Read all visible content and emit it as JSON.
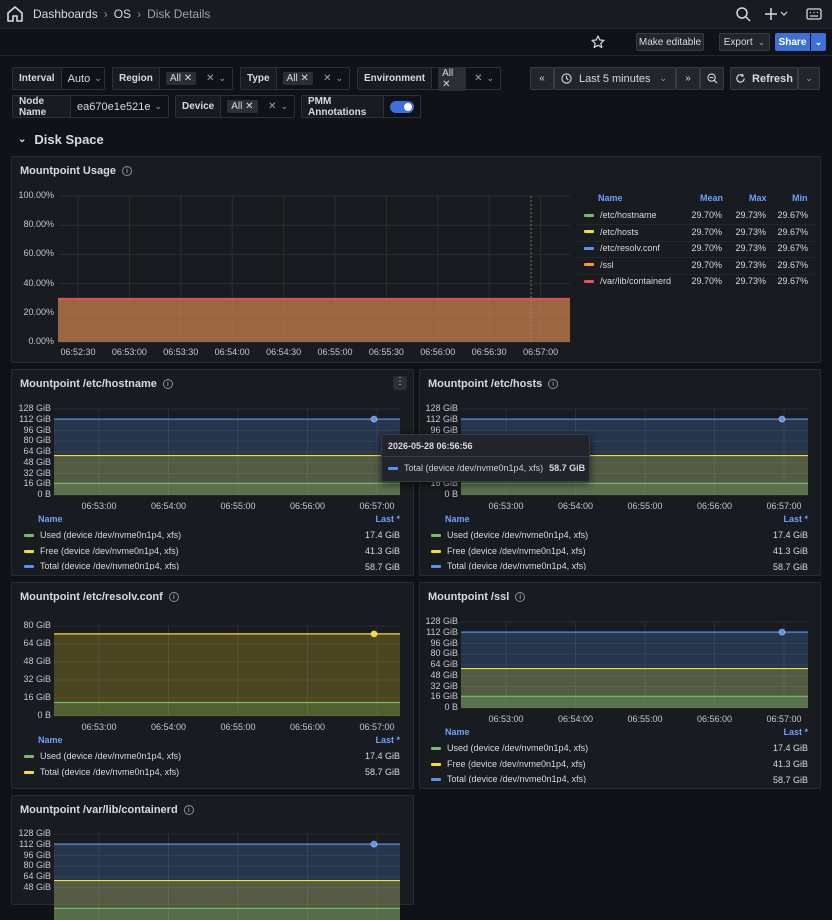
{
  "breadcrumbs": [
    "Dashboards",
    "OS",
    "Disk Details"
  ],
  "toolbar": {
    "make_editable": "Make editable",
    "export": "Export",
    "share": "Share"
  },
  "variables": {
    "interval": {
      "label": "Interval",
      "value": "Auto"
    },
    "region": {
      "label": "Region",
      "value": "All"
    },
    "type": {
      "label": "Type",
      "value": "All"
    },
    "environment": {
      "label": "Environment",
      "value": "All"
    },
    "node_name": {
      "label": "Node Name",
      "value": "ea670e1e521e"
    },
    "device": {
      "label": "Device",
      "value": "All"
    },
    "pmm": {
      "label": "PMM Annotations",
      "enabled": true
    }
  },
  "time": {
    "range": "Last 5 minutes",
    "refresh": "Refresh"
  },
  "section_title": "Disk Space",
  "colors": {
    "used": "#73bf69",
    "free": "#fade2a",
    "total": "#5794f2",
    "ssl": "#ff9830",
    "containerd": "#f2495c",
    "accent": "#3d71d9"
  },
  "usage_panel": {
    "title": "Mountpoint Usage",
    "legend_headers": {
      "name": "Name",
      "mean": "Mean",
      "max": "Max",
      "min": "Min"
    },
    "series": [
      {
        "name": "/etc/hostname",
        "mean": "29.70%",
        "max": "29.73%",
        "min": "29.67%",
        "color": "#73bf69"
      },
      {
        "name": "/etc/hosts",
        "mean": "29.70%",
        "max": "29.73%",
        "min": "29.67%",
        "color": "#fade2a"
      },
      {
        "name": "/etc/resolv.conf",
        "mean": "29.70%",
        "max": "29.73%",
        "min": "29.67%",
        "color": "#5794f2"
      },
      {
        "name": "/ssl",
        "mean": "29.70%",
        "max": "29.73%",
        "min": "29.67%",
        "color": "#ff9830"
      },
      {
        "name": "/var/lib/containerd",
        "mean": "29.70%",
        "max": "29.73%",
        "min": "29.67%",
        "color": "#f2495c"
      }
    ],
    "y_ticks": [
      "100.00%",
      "80.00%",
      "60.00%",
      "40.00%",
      "20.00%",
      "0.00%"
    ],
    "x_ticks": [
      "06:52:30",
      "06:53:00",
      "06:53:30",
      "06:54:00",
      "06:54:30",
      "06:55:00",
      "06:55:30",
      "06:56:00",
      "06:56:30",
      "06:57:00"
    ]
  },
  "chart_data": [
    {
      "type": "area",
      "title": "Mountpoint Usage",
      "ylim": [
        0,
        100
      ],
      "series": [
        {
          "name": "/var/lib/containerd",
          "value": 29.7
        }
      ]
    },
    {
      "type": "line",
      "title": "Mountpoint /etc/hostname",
      "ylim_gib": [
        0,
        128
      ],
      "series": [
        {
          "name": "Used",
          "value": 17.4
        },
        {
          "name": "Free",
          "value": 41.3
        },
        {
          "name": "Total",
          "value": 58.7
        }
      ]
    },
    {
      "type": "line",
      "title": "Mountpoint /etc/hosts",
      "ylim_gib": [
        0,
        128
      ],
      "series": [
        {
          "name": "Used",
          "value": 17.4
        },
        {
          "name": "Free",
          "value": 41.3
        },
        {
          "name": "Total",
          "value": 58.7
        }
      ]
    },
    {
      "type": "line",
      "title": "Mountpoint /etc/resolv.conf",
      "ylim_gib": [
        0,
        80
      ],
      "series": [
        {
          "name": "Used",
          "value": 17.4
        },
        {
          "name": "Total",
          "value": 58.7
        }
      ]
    },
    {
      "type": "line",
      "title": "Mountpoint /ssl",
      "ylim_gib": [
        0,
        128
      ],
      "series": [
        {
          "name": "Used",
          "value": 17.4
        },
        {
          "name": "Free",
          "value": 41.3
        },
        {
          "name": "Total",
          "value": 58.7
        }
      ]
    }
  ],
  "small_panels": {
    "name_header": "Name",
    "last_header": "Last *",
    "x_ticks": [
      "06:53:00",
      "06:54:00",
      "06:55:00",
      "06:56:00",
      "06:57:00"
    ],
    "y_ticks_128": [
      "128 GiB",
      "112 GiB",
      "96 GiB",
      "80 GiB",
      "64 GiB",
      "48 GiB",
      "32 GiB",
      "16 GiB",
      "0 B"
    ],
    "y_ticks_80": [
      "80 GiB",
      "64 GiB",
      "48 GiB",
      "32 GiB",
      "16 GiB",
      "0 B"
    ],
    "hostname": {
      "title": "Mountpoint /etc/hostname"
    },
    "hosts": {
      "title": "Mountpoint /etc/hosts"
    },
    "resolv": {
      "title": "Mountpoint /etc/resolv.conf"
    },
    "ssl": {
      "title": "Mountpoint /ssl"
    },
    "containerd": {
      "title": "Mountpoint /var/lib/containerd"
    },
    "used_label": "Used (device /dev/nvme0n1p4, xfs)",
    "free_label": "Free (device /dev/nvme0n1p4, xfs)",
    "total_label": "Total (device /dev/nvme0n1p4, xfs)",
    "used_value": "17.4 GiB",
    "free_value": "41.3 GiB",
    "total_value": "58.7 GiB"
  },
  "tooltip": {
    "time": "2026-05-28 06:56:56",
    "label": "Total (device /dev/nvme0n1p4, xfs)",
    "value": "58.7 GiB"
  }
}
